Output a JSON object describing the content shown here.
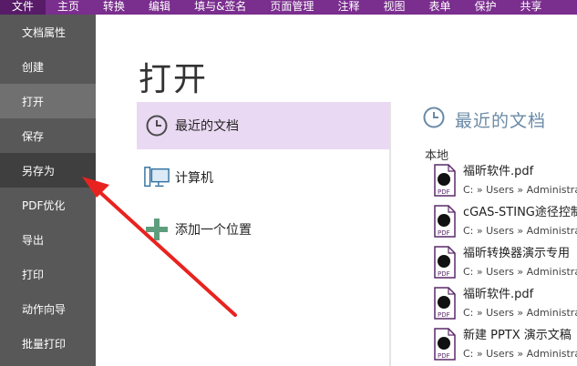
{
  "menubar": {
    "items": [
      {
        "label": "文件",
        "active": true
      },
      {
        "label": "主页"
      },
      {
        "label": "转换"
      },
      {
        "label": "编辑"
      },
      {
        "label": "填与&签名"
      },
      {
        "label": "页面管理"
      },
      {
        "label": "注释"
      },
      {
        "label": "视图"
      },
      {
        "label": "表单"
      },
      {
        "label": "保护"
      },
      {
        "label": "共享"
      }
    ]
  },
  "sidebar": {
    "items": [
      {
        "label": "文档属性"
      },
      {
        "label": "创建"
      },
      {
        "label": "打开"
      },
      {
        "label": "保存"
      },
      {
        "label": "另存为"
      },
      {
        "label": "PDF优化"
      },
      {
        "label": "导出"
      },
      {
        "label": "打印"
      },
      {
        "label": "动作向导"
      },
      {
        "label": "批量打印"
      }
    ]
  },
  "main": {
    "title": "打开",
    "places": [
      {
        "label": "最近的文档",
        "icon": "clock-icon"
      },
      {
        "label": "计算机",
        "icon": "computer-icon"
      },
      {
        "label": "添加一个位置",
        "icon": "plus-icon"
      }
    ],
    "recent": {
      "title": "最近的文档",
      "section": "本地",
      "files": [
        {
          "name": "福昕软件.pdf",
          "path": "C: » Users » Administra"
        },
        {
          "name": "cGAS-STING途径控制",
          "path": "C: » Users » Administra"
        },
        {
          "name": "福昕转换器演示专用",
          "path": "C: » Users » Administra"
        },
        {
          "name": "福昕软件.pdf",
          "path": "C: » Users » Administra"
        },
        {
          "name": "新建 PPTX 演示文稿",
          "path": "C: » Users » Administra"
        }
      ]
    }
  },
  "colors": {
    "menubar": "#7a2e8e",
    "sidebar": "#585858",
    "selected_place": "#ead9f2",
    "recent_title": "#6a8aa6",
    "annotation_arrow": "#e8231f"
  }
}
